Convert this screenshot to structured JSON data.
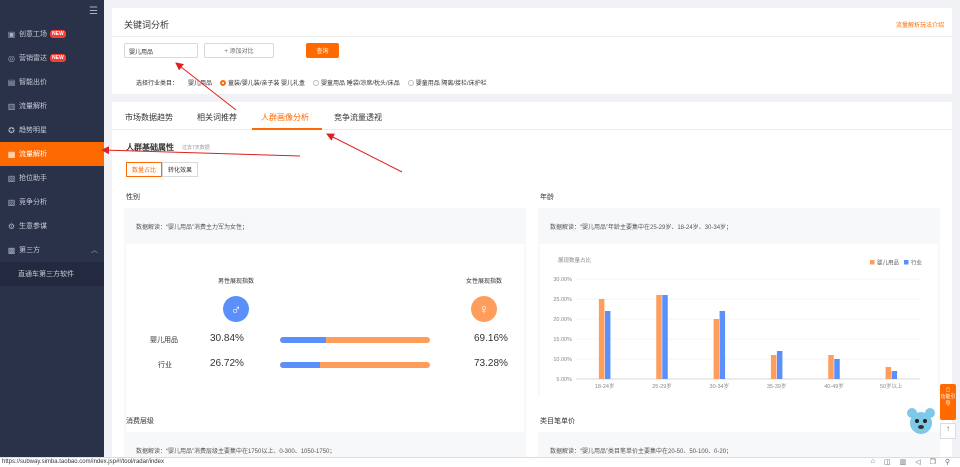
{
  "sidebar": {
    "items": [
      {
        "label": "创意工场",
        "icon": "creative-icon",
        "badge": "NEW"
      },
      {
        "label": "营销雷达",
        "icon": "radar-icon",
        "badge": "NEW"
      },
      {
        "label": "智能出价",
        "icon": "bid-icon",
        "badge": ""
      },
      {
        "label": "流量解析",
        "icon": "traffic-icon",
        "badge": ""
      },
      {
        "label": "趋势明星",
        "icon": "trend-icon",
        "badge": ""
      },
      {
        "label": "流量解析",
        "icon": "traffic-analysis-icon",
        "badge": ""
      },
      {
        "label": "抢位助手",
        "icon": "position-icon",
        "badge": ""
      },
      {
        "label": "竞争分析",
        "icon": "competition-icon",
        "badge": ""
      },
      {
        "label": "生意参谋",
        "icon": "business-icon",
        "badge": ""
      },
      {
        "label": "第三方",
        "icon": "third-party-icon",
        "badge": ""
      }
    ],
    "sub_item": "直通车第三方软件",
    "active_color": "#ff6a00"
  },
  "keyword_panel": {
    "title": "关键词分析",
    "help_link": "流量解析玩法介绍",
    "input_value": "婴儿用品",
    "add_label": "+ 添加对比",
    "query_label": "查询",
    "industry_label": "选择行业类目：",
    "industry_prefix": "婴儿用品",
    "options": [
      {
        "label": "童装/婴儿装/亲子装 婴儿礼盒",
        "checked": true
      },
      {
        "label": "婴童用品 睡袋/凉席/枕头/床品",
        "checked": false
      },
      {
        "label": "婴童用品 隔离/接栏/床护栏",
        "checked": false
      }
    ]
  },
  "tabs": [
    "市场数据趋势",
    "相关词推荐",
    "人群画像分析",
    "竞争流量透视"
  ],
  "active_tab": 2,
  "crowd": {
    "title": "人群基础属性",
    "subtitle": "过去7天数据",
    "seg": [
      "数量占比",
      "转化效果"
    ],
    "gender": {
      "title": "性别",
      "interp": "数据解读：“婴儿用品”消费主力军为女性；",
      "male_label": "男性展现指数",
      "female_label": "女性展现指数",
      "rows": [
        {
          "label": "婴儿用品",
          "male": "30.84%",
          "female": "69.16%",
          "male_frac": 0.3084
        },
        {
          "label": "行业",
          "male": "26.72%",
          "female": "73.28%",
          "male_frac": 0.2672
        }
      ],
      "male_color": "#5b8ff9",
      "female_color": "#ff9d5c"
    },
    "age": {
      "title": "年龄",
      "interp": "数据解读：“婴儿用品”年龄主要集中在25-29岁、18-24岁、30-34岁；"
    },
    "consume": {
      "title": "消费层级",
      "interp": "数据解读：“婴儿用品”消费层级主要集中在1750以上、0-300、1050-1750；"
    },
    "price": {
      "title": "类目笔单价",
      "interp": "数据解读：“婴儿用品”类目笔单价主要集中在20-50、50-100、0-20；"
    }
  },
  "chart_data": {
    "type": "bar",
    "ylabel": "展现数量占比",
    "categories": [
      "18-24岁",
      "25-29岁",
      "30-34岁",
      "35-39岁",
      "40-49岁",
      "50岁以上"
    ],
    "series": [
      {
        "name": "婴儿用品",
        "color": "#ff9d5c",
        "values": [
          25,
          26,
          20,
          11,
          11,
          8
        ]
      },
      {
        "name": "行业",
        "color": "#5b8ff9",
        "values": [
          22,
          26,
          22,
          12,
          10,
          7
        ]
      }
    ],
    "yticks": [
      "5.00%",
      "10.00%",
      "15.00%",
      "20.00%",
      "25.00%",
      "30.00%"
    ],
    "ylim": [
      5,
      30
    ],
    "grid": true,
    "legend": "top-right"
  },
  "float": {
    "label": "功能引导"
  },
  "statusbar": {
    "url": "https://subway.simba.taobao.com/index.jsp#!/tool/radar/index",
    "icons": [
      "shop-icon",
      "game-icon",
      "trash-icon",
      "sound-icon",
      "window-icon",
      "search-icon"
    ]
  }
}
